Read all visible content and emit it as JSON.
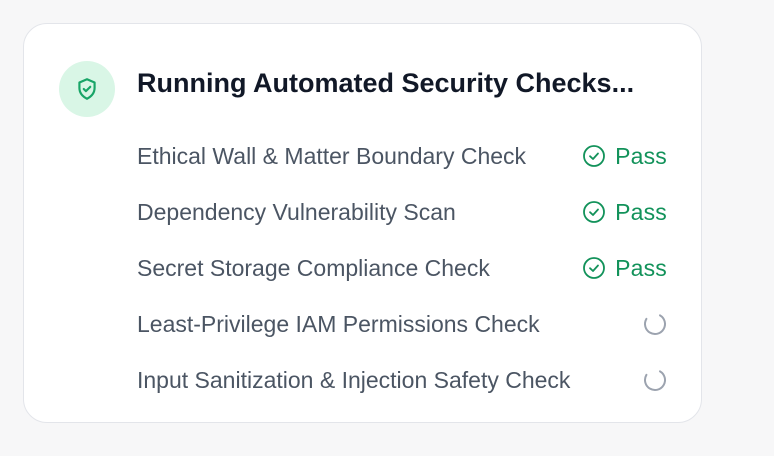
{
  "card": {
    "title": "Running Automated Security Checks...",
    "checks": [
      {
        "label": "Ethical Wall & Matter Boundary Check",
        "status": "Pass"
      },
      {
        "label": "Dependency Vulnerability Scan",
        "status": "Pass"
      },
      {
        "label": "Secret Storage Compliance Check",
        "status": "Pass"
      },
      {
        "label": "Least-Privilege IAM Permissions Check",
        "status": ""
      },
      {
        "label": "Input Sanitization & Injection Safety Check",
        "status": ""
      }
    ]
  },
  "colors": {
    "accent_green": "#12925a",
    "badge_bg": "#d9f6e6",
    "spinner": "#9ca3af"
  },
  "icons": {
    "header": "shield-check-icon",
    "pass": "check-circle-icon",
    "running": "loading-spinner-icon"
  }
}
